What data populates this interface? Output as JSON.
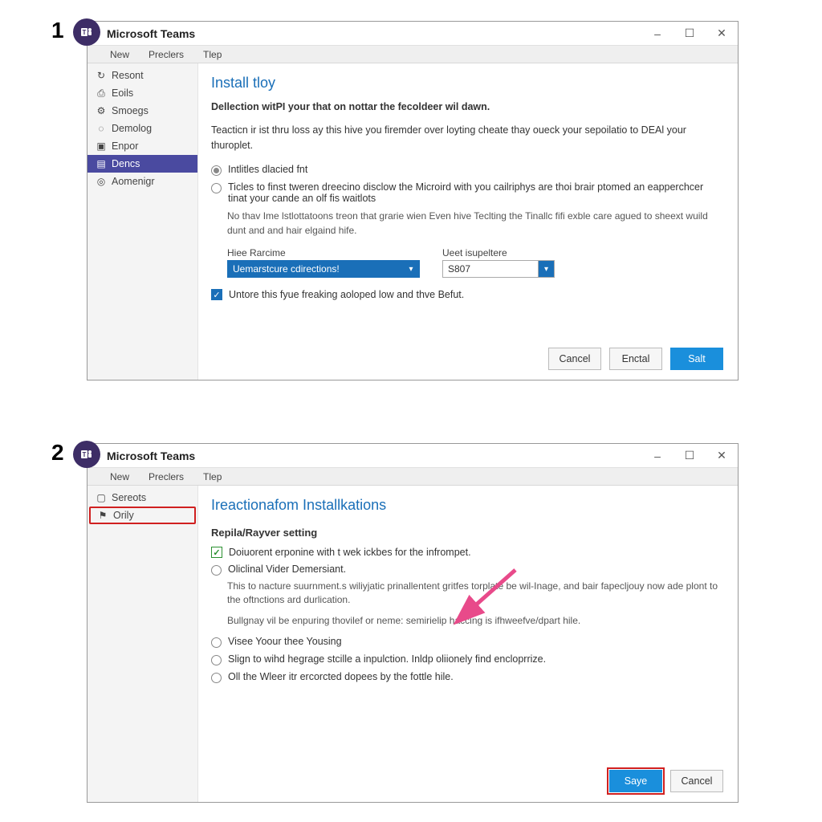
{
  "step1_num": "1",
  "step2_num": "2",
  "app_title": "Microsoft Teams",
  "logo_text": "T",
  "menu": {
    "new": "New",
    "prefs": "Preclers",
    "tip": "Tlep"
  },
  "win1": {
    "sidebar": [
      {
        "icon": "↻",
        "label": "Resont"
      },
      {
        "icon": "⎙",
        "label": "Eoils"
      },
      {
        "icon": "⚙",
        "label": "Smoegs"
      },
      {
        "icon": "◌",
        "label": "Demolog"
      },
      {
        "icon": "▣",
        "label": "Enpor"
      },
      {
        "icon": "▤",
        "label": "Dencs"
      },
      {
        "icon": "◎",
        "label": "Aomenigr"
      }
    ],
    "page_title": "Install tloy",
    "desc1": "Dellection witPI your that on nottar the fecoldeer wil dawn.",
    "desc2": "Teacticn ir ist thru loss ay this hive you firemder over loyting cheate thay oueck your sepoilatio to DEAl your thuroplet.",
    "radio1": "Intlitles dlacied fnt",
    "radio2": "Ticles to finst tweren dreecino disclow the Microird with you cailriphys are thoi brair ptomed an eapperchcer tinat your cande an olf fis waitlots",
    "subdesc": "No thav Ime lstlottatoons treon that grarie wien Even hive Teclting the Tinallc fifi exble care agued to sheext wuild dunt and and hair elgaind hife.",
    "field1_label": "Hiee Rarcime",
    "field1_value": "Uemarstcure cdirections!",
    "field2_label": "Ueet isupeltere",
    "field2_value": "S807",
    "chk_label": "Untore this fyue freaking aoloped low and thve Befut.",
    "btn_cancel": "Cancel",
    "btn_enctal": "Enctal",
    "btn_salt": "Salt"
  },
  "win2": {
    "sidebar": [
      {
        "icon": "▢",
        "label": "Sereots"
      },
      {
        "icon": "⚑",
        "label": "Orily"
      }
    ],
    "page_title": "Ireactionafom Installkations",
    "section_sub": "Repila/Rayver setting",
    "chk1": "Doiuorent erponine with t wek ickbes for the infrompet.",
    "radio_a": "Oliclinal Vider Demersiant.",
    "desc_a1": "This to nacture suurnment.s wiliyjatic prinallentent gritfes torplate be wil-Inage, and bair fapecljouy now ade plont to the oftnctions ard durlication.",
    "desc_a2": "Bullgnay vil be enpuring thovilef or neme: semirielip haccing is ifhweefve/dpart hile.",
    "radio_b": "Visee Yoour thee Yousing",
    "radio_c": "Slign to wihd hegrage stcille a inpulction. Inldp oliionely find encloprrize.",
    "radio_d": "Oll the Wleer itr ercorcted dopees by the fottle hile.",
    "btn_save": "Saye",
    "btn_cancel": "Cancel"
  }
}
